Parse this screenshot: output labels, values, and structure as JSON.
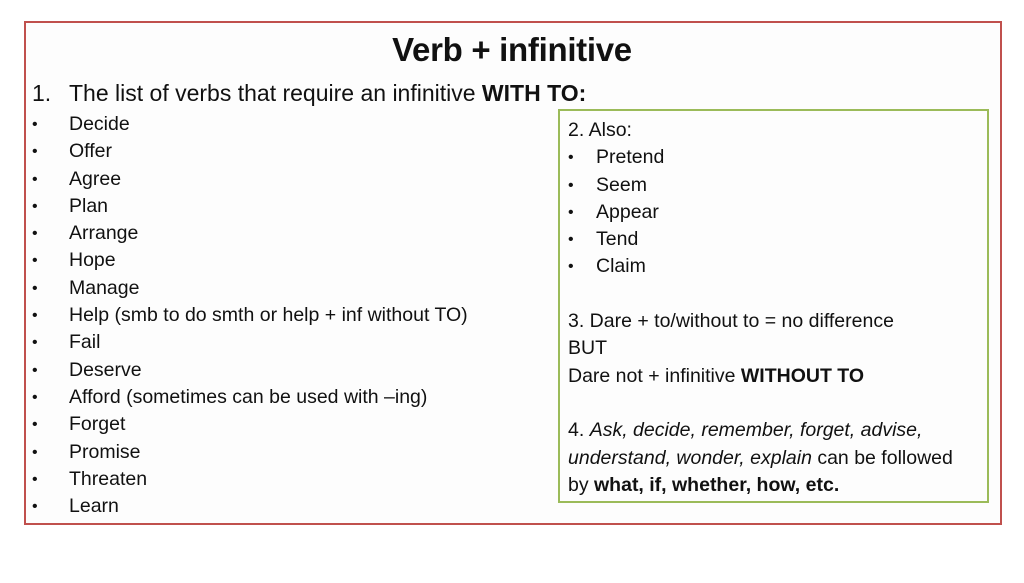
{
  "title": "Verb + infinitive",
  "section1": {
    "number": "1.",
    "text": "The list of verbs that require an infinitive ",
    "emphasis": "WITH TO:",
    "bullet_glyph": "•",
    "items": [
      "Decide",
      "Offer",
      "Agree",
      "Plan",
      "Arrange",
      "Hope",
      "Manage",
      "Help (smb to do smth or help + inf without TO)",
      "Fail",
      "Deserve",
      "Afford (sometimes can be used with –ing)",
      "Forget",
      "Promise",
      "Threaten",
      "Learn"
    ]
  },
  "box": {
    "section2": {
      "heading": "2. Also:",
      "items": [
        "Pretend",
        "Seem",
        "Appear",
        "Tend",
        "Claim"
      ]
    },
    "section3": {
      "line1": "3. Dare + to/without to = no difference",
      "line2": "BUT",
      "line3_prefix": "Dare not + infinitive ",
      "line3_bold": "WITHOUT TO"
    },
    "section4": {
      "prefix": "4. ",
      "italic1": "Ask, decide, remember, forget, advise,",
      "italic2": "understand, wonder, explain",
      "plain2": " can be followed",
      "plain3": "by ",
      "bold3": "what, if, whether, how, etc."
    }
  },
  "colors": {
    "outer_border": "#c0504d",
    "inner_border": "#9bbb59",
    "text": "#111111"
  }
}
